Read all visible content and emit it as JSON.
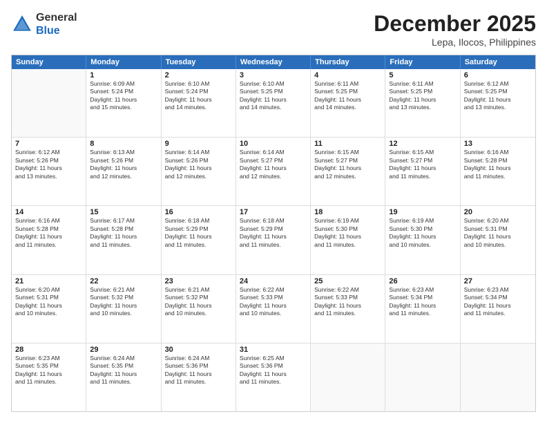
{
  "logo": {
    "general": "General",
    "blue": "Blue"
  },
  "title": {
    "month_year": "December 2025",
    "location": "Lepa, Ilocos, Philippines"
  },
  "days_of_week": [
    "Sunday",
    "Monday",
    "Tuesday",
    "Wednesday",
    "Thursday",
    "Friday",
    "Saturday"
  ],
  "weeks": [
    [
      {
        "day": "",
        "info": ""
      },
      {
        "day": "1",
        "info": "Sunrise: 6:09 AM\nSunset: 5:24 PM\nDaylight: 11 hours\nand 15 minutes."
      },
      {
        "day": "2",
        "info": "Sunrise: 6:10 AM\nSunset: 5:24 PM\nDaylight: 11 hours\nand 14 minutes."
      },
      {
        "day": "3",
        "info": "Sunrise: 6:10 AM\nSunset: 5:25 PM\nDaylight: 11 hours\nand 14 minutes."
      },
      {
        "day": "4",
        "info": "Sunrise: 6:11 AM\nSunset: 5:25 PM\nDaylight: 11 hours\nand 14 minutes."
      },
      {
        "day": "5",
        "info": "Sunrise: 6:11 AM\nSunset: 5:25 PM\nDaylight: 11 hours\nand 13 minutes."
      },
      {
        "day": "6",
        "info": "Sunrise: 6:12 AM\nSunset: 5:25 PM\nDaylight: 11 hours\nand 13 minutes."
      }
    ],
    [
      {
        "day": "7",
        "info": "Sunrise: 6:12 AM\nSunset: 5:26 PM\nDaylight: 11 hours\nand 13 minutes."
      },
      {
        "day": "8",
        "info": "Sunrise: 6:13 AM\nSunset: 5:26 PM\nDaylight: 11 hours\nand 12 minutes."
      },
      {
        "day": "9",
        "info": "Sunrise: 6:14 AM\nSunset: 5:26 PM\nDaylight: 11 hours\nand 12 minutes."
      },
      {
        "day": "10",
        "info": "Sunrise: 6:14 AM\nSunset: 5:27 PM\nDaylight: 11 hours\nand 12 minutes."
      },
      {
        "day": "11",
        "info": "Sunrise: 6:15 AM\nSunset: 5:27 PM\nDaylight: 11 hours\nand 12 minutes."
      },
      {
        "day": "12",
        "info": "Sunrise: 6:15 AM\nSunset: 5:27 PM\nDaylight: 11 hours\nand 11 minutes."
      },
      {
        "day": "13",
        "info": "Sunrise: 6:16 AM\nSunset: 5:28 PM\nDaylight: 11 hours\nand 11 minutes."
      }
    ],
    [
      {
        "day": "14",
        "info": "Sunrise: 6:16 AM\nSunset: 5:28 PM\nDaylight: 11 hours\nand 11 minutes."
      },
      {
        "day": "15",
        "info": "Sunrise: 6:17 AM\nSunset: 5:28 PM\nDaylight: 11 hours\nand 11 minutes."
      },
      {
        "day": "16",
        "info": "Sunrise: 6:18 AM\nSunset: 5:29 PM\nDaylight: 11 hours\nand 11 minutes."
      },
      {
        "day": "17",
        "info": "Sunrise: 6:18 AM\nSunset: 5:29 PM\nDaylight: 11 hours\nand 11 minutes."
      },
      {
        "day": "18",
        "info": "Sunrise: 6:19 AM\nSunset: 5:30 PM\nDaylight: 11 hours\nand 11 minutes."
      },
      {
        "day": "19",
        "info": "Sunrise: 6:19 AM\nSunset: 5:30 PM\nDaylight: 11 hours\nand 10 minutes."
      },
      {
        "day": "20",
        "info": "Sunrise: 6:20 AM\nSunset: 5:31 PM\nDaylight: 11 hours\nand 10 minutes."
      }
    ],
    [
      {
        "day": "21",
        "info": "Sunrise: 6:20 AM\nSunset: 5:31 PM\nDaylight: 11 hours\nand 10 minutes."
      },
      {
        "day": "22",
        "info": "Sunrise: 6:21 AM\nSunset: 5:32 PM\nDaylight: 11 hours\nand 10 minutes."
      },
      {
        "day": "23",
        "info": "Sunrise: 6:21 AM\nSunset: 5:32 PM\nDaylight: 11 hours\nand 10 minutes."
      },
      {
        "day": "24",
        "info": "Sunrise: 6:22 AM\nSunset: 5:33 PM\nDaylight: 11 hours\nand 10 minutes."
      },
      {
        "day": "25",
        "info": "Sunrise: 6:22 AM\nSunset: 5:33 PM\nDaylight: 11 hours\nand 11 minutes."
      },
      {
        "day": "26",
        "info": "Sunrise: 6:23 AM\nSunset: 5:34 PM\nDaylight: 11 hours\nand 11 minutes."
      },
      {
        "day": "27",
        "info": "Sunrise: 6:23 AM\nSunset: 5:34 PM\nDaylight: 11 hours\nand 11 minutes."
      }
    ],
    [
      {
        "day": "28",
        "info": "Sunrise: 6:23 AM\nSunset: 5:35 PM\nDaylight: 11 hours\nand 11 minutes."
      },
      {
        "day": "29",
        "info": "Sunrise: 6:24 AM\nSunset: 5:35 PM\nDaylight: 11 hours\nand 11 minutes."
      },
      {
        "day": "30",
        "info": "Sunrise: 6:24 AM\nSunset: 5:36 PM\nDaylight: 11 hours\nand 11 minutes."
      },
      {
        "day": "31",
        "info": "Sunrise: 6:25 AM\nSunset: 5:36 PM\nDaylight: 11 hours\nand 11 minutes."
      },
      {
        "day": "",
        "info": ""
      },
      {
        "day": "",
        "info": ""
      },
      {
        "day": "",
        "info": ""
      }
    ]
  ]
}
